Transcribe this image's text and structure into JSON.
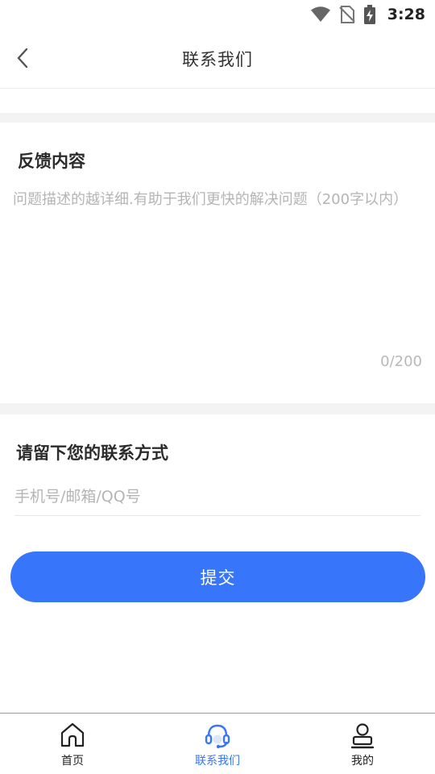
{
  "status_bar": {
    "time": "3:28",
    "icons": [
      "wifi-icon",
      "no-sim-icon",
      "battery-charging-icon"
    ]
  },
  "header": {
    "title": "联系我们",
    "back_icon": "chevron-left-icon"
  },
  "feedback": {
    "title": "反馈内容",
    "placeholder": "问题描述的越详细.有助于我们更快的解决问题（200字以内）",
    "value": "",
    "count": "0/200"
  },
  "contact": {
    "title": "请留下您的联系方式",
    "placeholder": "手机号/邮箱/QQ号",
    "value": ""
  },
  "submit_label": "提交",
  "nav": {
    "items": [
      {
        "label": "首页",
        "icon": "home-icon",
        "active": false
      },
      {
        "label": "联系我们",
        "icon": "headset-icon",
        "active": true
      },
      {
        "label": "我的",
        "icon": "user-icon",
        "active": false
      }
    ]
  },
  "colors": {
    "accent": "#3775fb",
    "background": "#ffffff",
    "section_gap": "#f3f3f3",
    "placeholder": "#b5b5b5",
    "text": "#333333"
  }
}
